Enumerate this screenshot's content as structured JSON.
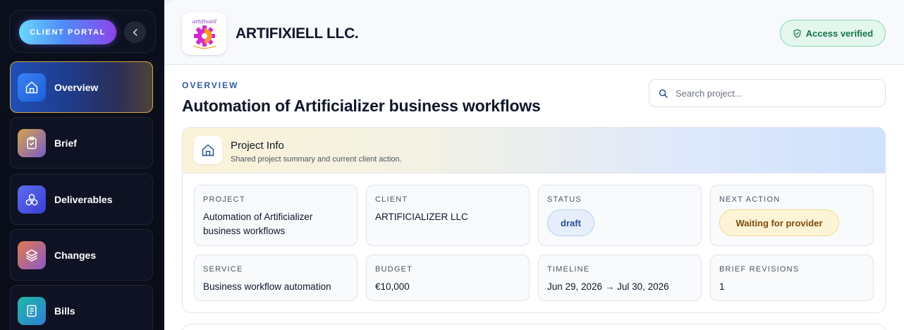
{
  "sidebar": {
    "portal_label": "CLIENT PORTAL",
    "collapse_glyph": "‹",
    "items": [
      {
        "label": "Overview",
        "icon": "home-icon",
        "color": "#2f6fe0",
        "active": true
      },
      {
        "label": "Brief",
        "icon": "clipboard-check-icon",
        "color": "#b98a3e",
        "active": false
      },
      {
        "label": "Deliverables",
        "icon": "boxes-icon",
        "color": "#4f5fe6",
        "active": false
      },
      {
        "label": "Changes",
        "icon": "layers-icon",
        "color": "#c56a52",
        "active": false
      },
      {
        "label": "Bills",
        "icon": "document-icon",
        "color": "#19a59b",
        "active": false
      }
    ]
  },
  "header": {
    "company_name": "ARTIFIXIELL LLC.",
    "logo_text": "artifixiell",
    "verified_label": "Access verified",
    "verified_color": "#157348"
  },
  "main": {
    "eyebrow": "OVERVIEW",
    "title": "Automation of Artificializer business workflows",
    "search_placeholder": "Search project..."
  },
  "project_info": {
    "title": "Project Info",
    "subtitle": "Shared project summary and current client action.",
    "fields": {
      "project": {
        "label": "PROJECT",
        "value": "Automation of Artificializer business workflows"
      },
      "client": {
        "label": "CLIENT",
        "value": "ARTIFICIALIZER LLC"
      },
      "status": {
        "label": "STATUS",
        "value": "draft"
      },
      "next_action": {
        "label": "NEXT ACTION",
        "value": "Waiting for provider"
      },
      "service": {
        "label": "SERVICE",
        "value": "Business workflow automation"
      },
      "budget": {
        "label": "BUDGET",
        "value": "€10,000"
      },
      "timeline": {
        "label": "TIMELINE",
        "value": "Jun 29, 2026 → Jul 30, 2026"
      },
      "brief_revisions": {
        "label": "BRIEF REVISIONS",
        "value": "1"
      }
    }
  }
}
